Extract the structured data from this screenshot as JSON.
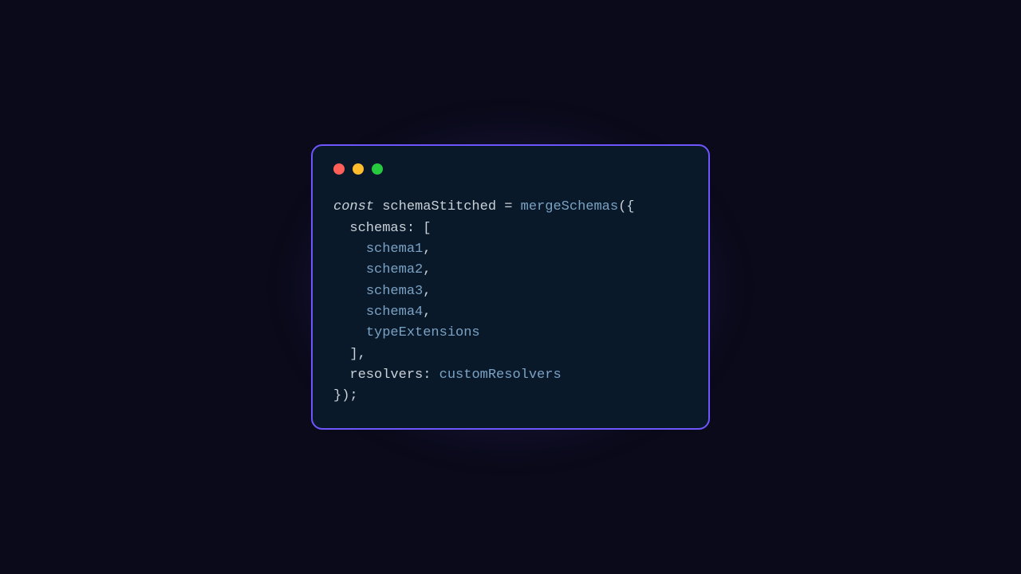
{
  "code": {
    "keyword_const": "const",
    "variable": "schemaStitched",
    "equals": "=",
    "func_name": "mergeSchemas",
    "open": "({",
    "prop_schemas": "schemas",
    "colon1": ":",
    "bracket_open": "[",
    "item1": "schema1",
    "item2": "schema2",
    "item3": "schema3",
    "item4": "schema4",
    "item5": "typeExtensions",
    "comma": ",",
    "bracket_close": "]",
    "prop_resolvers": "resolvers",
    "colon2": ":",
    "value_resolvers": "customResolvers",
    "close": "});"
  },
  "traffic": {
    "red": "close",
    "yellow": "minimize",
    "green": "zoom"
  }
}
